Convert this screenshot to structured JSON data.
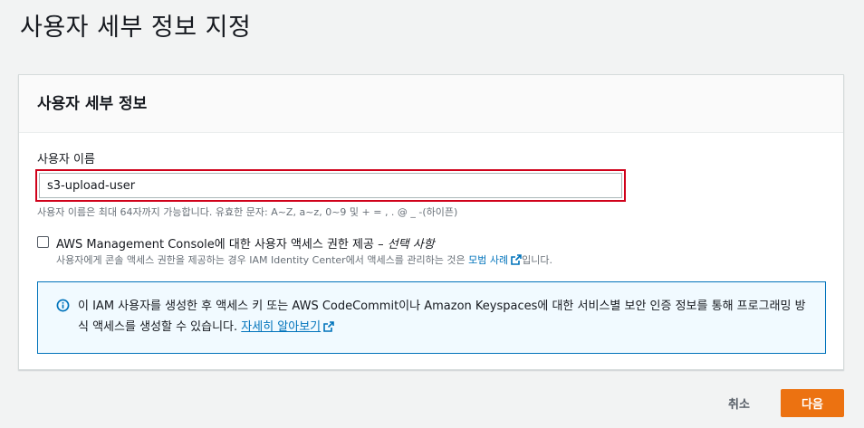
{
  "page": {
    "title": "사용자 세부 정보 지정"
  },
  "panel": {
    "title": "사용자 세부 정보",
    "username": {
      "label": "사용자 이름",
      "value": "s3-upload-user",
      "constraint": "사용자 이름은 최대 64자까지 가능합니다. 유효한 문자: A~Z, a~z, 0~9 및 + = , . @ _ -(하이픈)"
    },
    "console_access": {
      "label": "AWS Management Console에 대한 사용자 액세스 권한 제공 – ",
      "optional": "선택 사항",
      "checked": false,
      "description_prefix": "사용자에게 콘솔 액세스 권한을 제공하는 경우 IAM Identity Center에서 액세스를 관리하는 것은 ",
      "description_link": "모범 사례",
      "description_suffix": "입니다."
    },
    "info": {
      "text": "이 IAM 사용자를 생성한 후 액세스 키 또는 AWS CodeCommit이나 Amazon Keyspaces에 대한 서비스별 보안 인증 정보를 통해 프로그래밍 방식 액세스를 생성할 수 있습니다. ",
      "link": "자세히 알아보기"
    }
  },
  "footer": {
    "cancel_label": "취소",
    "next_label": "다음"
  },
  "colors": {
    "primary_button": "#ec7211",
    "link": "#0073bb",
    "highlight_border": "#d0021b",
    "info_background": "#f1faff"
  },
  "icons": {
    "info": "info-icon",
    "external": "external-link-icon"
  }
}
